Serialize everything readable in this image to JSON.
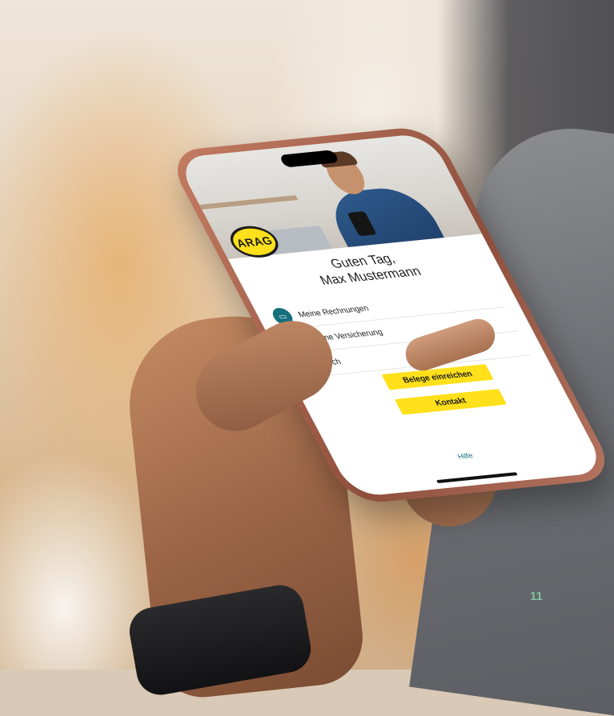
{
  "phone_app": {
    "logo_text": "ARAG",
    "greeting_line1": "Guten Tag,",
    "greeting_line2": "Max Mustermann",
    "menu_items": [
      {
        "label": "Meine Rechnungen",
        "icon": "folder-icon"
      },
      {
        "label": "Meine Versicherung",
        "icon": "document-icon"
      },
      {
        "label": "…ch",
        "icon": "file-icon"
      }
    ],
    "buttons": {
      "belege": "Belege einreichen",
      "kontakt": "Kontakt"
    },
    "help_link": "Hilfe"
  },
  "page": {
    "number": "11"
  },
  "colors": {
    "brand_yellow": "#ffe01b",
    "brand_teal": "#15707c",
    "page_number": "#7fc3a2"
  }
}
